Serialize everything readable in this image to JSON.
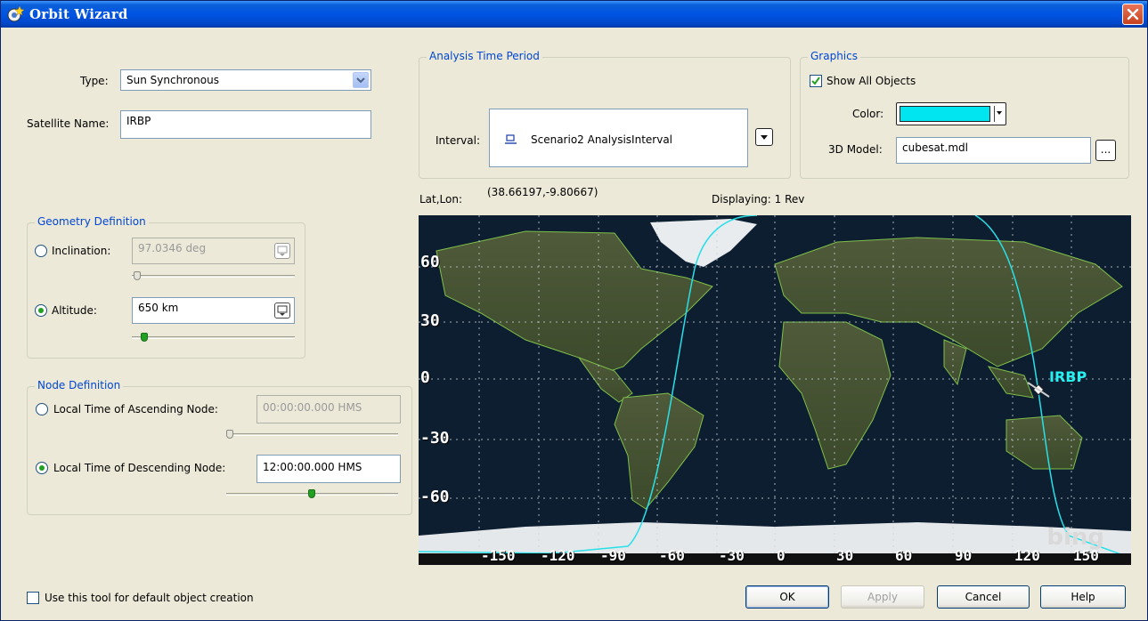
{
  "window": {
    "title": "Orbit Wizard"
  },
  "type_field": {
    "label": "Type:",
    "value": "Sun Synchronous"
  },
  "name_field": {
    "label": "Satellite Name:",
    "value": "IRBP"
  },
  "geometry": {
    "title": "Geometry Definition",
    "inclination_label": "Inclination:",
    "inclination_value": "97.0346 deg",
    "altitude_label": "Altitude:",
    "altitude_value": "650 km"
  },
  "node": {
    "title": "Node Definition",
    "ascending_label": "Local Time of Ascending Node:",
    "ascending_value": "00:00:00.000 HMS",
    "descending_label": "Local Time of Descending Node:",
    "descending_value": "12:00:00.000 HMS"
  },
  "analysis": {
    "title": "Analysis Time Period",
    "interval_label": "Interval:",
    "interval_value": "Scenario2 AnalysisInterval"
  },
  "graphics": {
    "title": "Graphics",
    "show_all_label": "Show All Objects",
    "color_label": "Color:",
    "color_value": "#00e5f0",
    "model_label": "3D Model:",
    "model_value": "cubesat.mdl",
    "browse_label": "..."
  },
  "map": {
    "latlon_label": "Lat,Lon:",
    "latlon_value": "(38.66197,-9.80667)",
    "displaying": "Displaying: 1 Rev",
    "lat_labels": [
      "60",
      "30",
      "0",
      "-30",
      "-60"
    ],
    "lon_labels": [
      "-150",
      "-120",
      "-90",
      "-60",
      "-30",
      "0",
      "30",
      "60",
      "90",
      "120",
      "150"
    ],
    "satellite_name": "IRBP",
    "watermark": "bing",
    "track_color": "#28e0e8"
  },
  "footer": {
    "default_creation_label": "Use this tool for default object creation",
    "ok": "OK",
    "apply": "Apply",
    "cancel": "Cancel",
    "help": "Help"
  }
}
